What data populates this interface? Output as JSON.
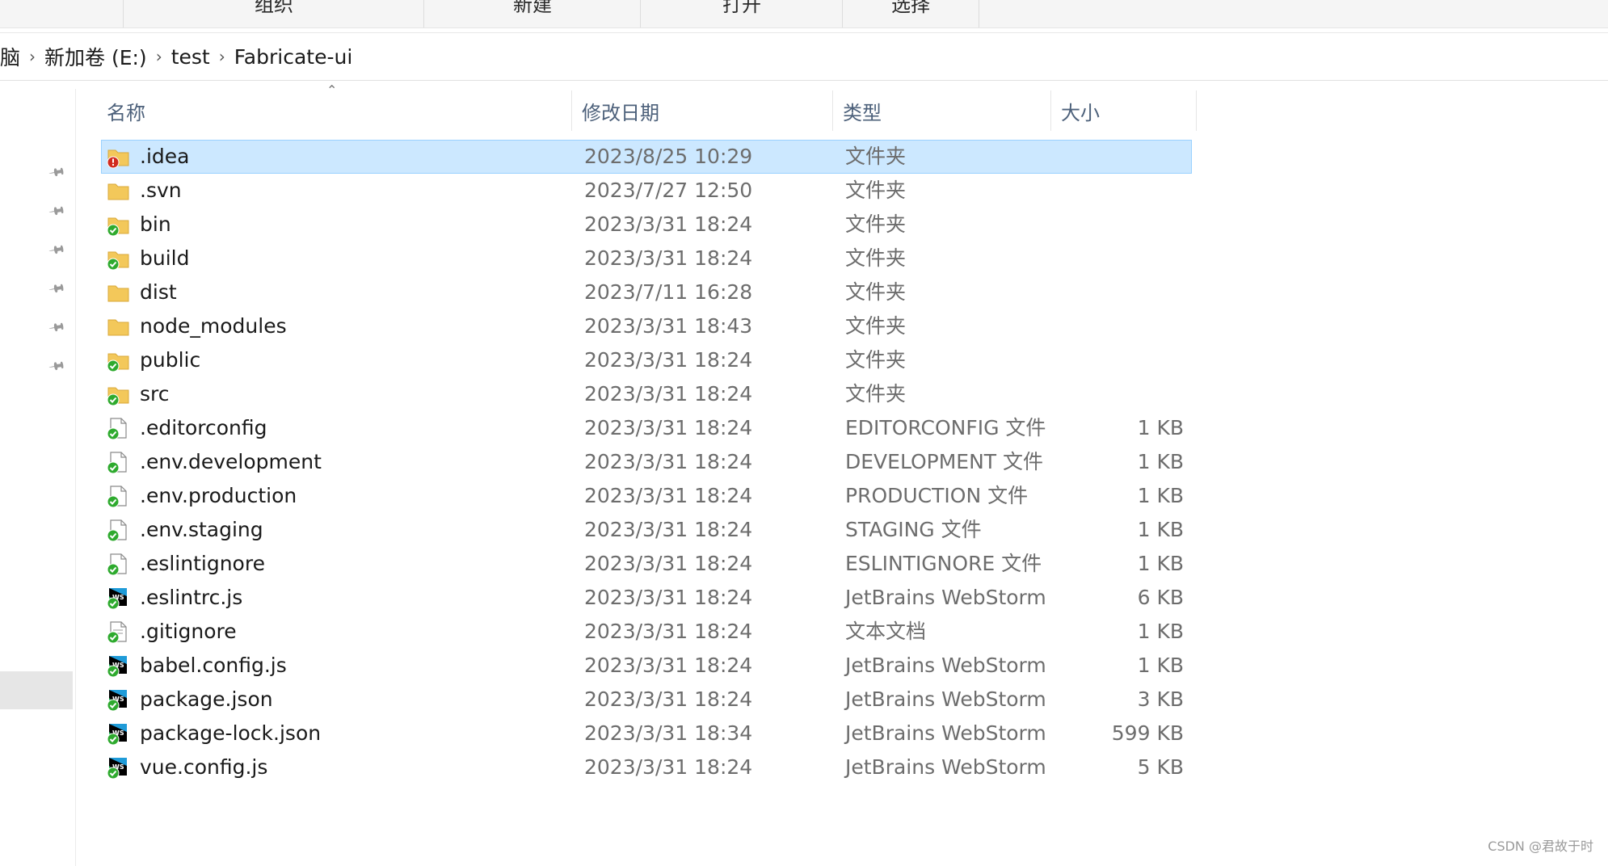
{
  "ribbon": {
    "groups": [
      "组织",
      "新建",
      "打开",
      "选择"
    ]
  },
  "address": {
    "crumbs": [
      "脑",
      "新加卷 (E:)",
      "test",
      "Fabricate-ui"
    ]
  },
  "columns": {
    "name": "名称",
    "date": "修改日期",
    "type": "类型",
    "size": "大小"
  },
  "files": [
    {
      "name": ".idea",
      "date": "2023/8/25 10:29",
      "type": "文件夹",
      "size": "",
      "icon": "folder-conflict-icon",
      "selected": true
    },
    {
      "name": ".svn",
      "date": "2023/7/27 12:50",
      "type": "文件夹",
      "size": "",
      "icon": "folder-icon"
    },
    {
      "name": "bin",
      "date": "2023/3/31 18:24",
      "type": "文件夹",
      "size": "",
      "icon": "folder-synced-icon"
    },
    {
      "name": "build",
      "date": "2023/3/31 18:24",
      "type": "文件夹",
      "size": "",
      "icon": "folder-synced-icon"
    },
    {
      "name": "dist",
      "date": "2023/7/11 16:28",
      "type": "文件夹",
      "size": "",
      "icon": "folder-icon"
    },
    {
      "name": "node_modules",
      "date": "2023/3/31 18:43",
      "type": "文件夹",
      "size": "",
      "icon": "folder-icon"
    },
    {
      "name": "public",
      "date": "2023/3/31 18:24",
      "type": "文件夹",
      "size": "",
      "icon": "folder-synced-icon"
    },
    {
      "name": "src",
      "date": "2023/3/31 18:24",
      "type": "文件夹",
      "size": "",
      "icon": "folder-synced-icon"
    },
    {
      "name": ".editorconfig",
      "date": "2023/3/31 18:24",
      "type": "EDITORCONFIG 文件",
      "size": "1 KB",
      "icon": "file-synced-icon"
    },
    {
      "name": ".env.development",
      "date": "2023/3/31 18:24",
      "type": "DEVELOPMENT 文件",
      "size": "1 KB",
      "icon": "file-synced-icon"
    },
    {
      "name": ".env.production",
      "date": "2023/3/31 18:24",
      "type": "PRODUCTION 文件",
      "size": "1 KB",
      "icon": "file-synced-icon"
    },
    {
      "name": ".env.staging",
      "date": "2023/3/31 18:24",
      "type": "STAGING 文件",
      "size": "1 KB",
      "icon": "file-synced-icon"
    },
    {
      "name": ".eslintignore",
      "date": "2023/3/31 18:24",
      "type": "ESLINTIGNORE 文件",
      "size": "1 KB",
      "icon": "file-synced-icon"
    },
    {
      "name": ".eslintrc.js",
      "date": "2023/3/31 18:24",
      "type": "JetBrains WebStorm",
      "size": "6 KB",
      "icon": "webstorm-synced-icon"
    },
    {
      "name": ".gitignore",
      "date": "2023/3/31 18:24",
      "type": "文本文档",
      "size": "1 KB",
      "icon": "text-file-synced-icon"
    },
    {
      "name": "babel.config.js",
      "date": "2023/3/31 18:24",
      "type": "JetBrains WebStorm",
      "size": "1 KB",
      "icon": "webstorm-synced-icon"
    },
    {
      "name": "package.json",
      "date": "2023/3/31 18:24",
      "type": "JetBrains WebStorm",
      "size": "3 KB",
      "icon": "webstorm-synced-icon"
    },
    {
      "name": "package-lock.json",
      "date": "2023/3/31 18:34",
      "type": "JetBrains WebStorm",
      "size": "599 KB",
      "icon": "webstorm-synced-icon"
    },
    {
      "name": "vue.config.js",
      "date": "2023/3/31 18:24",
      "type": "JetBrains WebStorm",
      "size": "5 KB",
      "icon": "webstorm-synced-icon"
    }
  ],
  "watermark": "CSDN @君故于时",
  "colors": {
    "selection": "#cce8ff",
    "header_text": "#4c607a",
    "folder": "#f3c85a",
    "sync_ok": "#2eaa2e",
    "conflict": "#d12b1f",
    "webstorm": "#1f9bd8"
  }
}
